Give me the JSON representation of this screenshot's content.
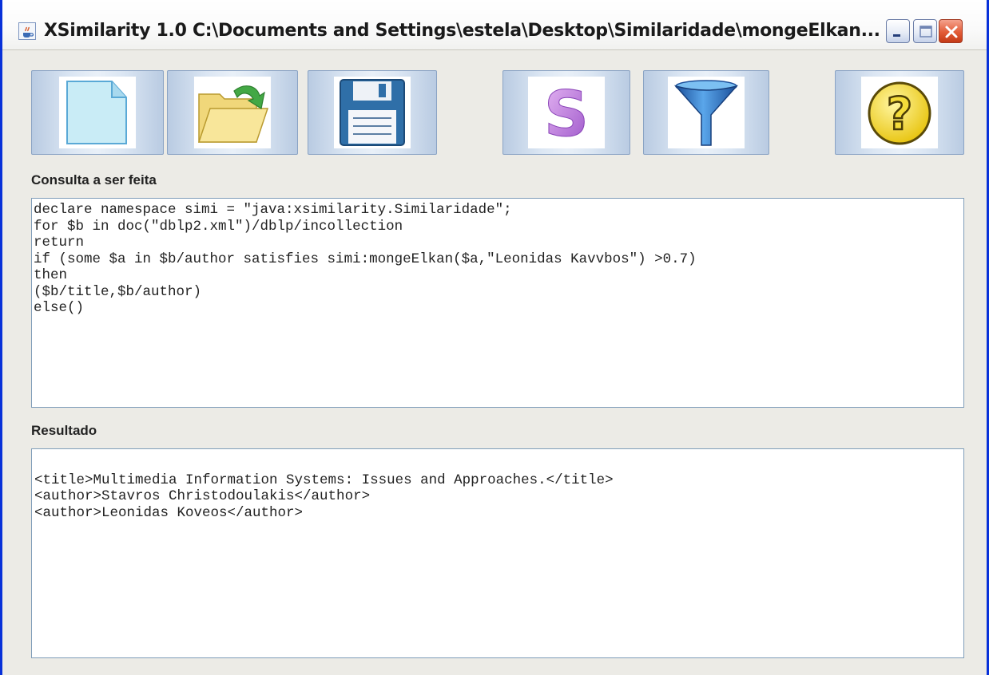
{
  "window": {
    "title": "XSimilarity 1.0 C:\\Documents and Settings\\estela\\Desktop\\Similaridade\\mongeElkan...",
    "app_icon": "java-cup-icon",
    "controls": [
      "minimize-icon",
      "maximize-icon",
      "close-icon"
    ]
  },
  "toolbar": {
    "buttons": [
      {
        "icon": "new-file-icon"
      },
      {
        "icon": "open-folder-icon"
      },
      {
        "icon": "save-disk-icon"
      },
      {
        "icon": "similarity-s-icon"
      },
      {
        "icon": "filter-funnel-icon"
      },
      {
        "icon": "help-question-icon"
      }
    ]
  },
  "query": {
    "label": "Consulta a ser feita",
    "lines": [
      "declare namespace simi = \"java:xsimilarity.Similaridade\";",
      "for $b in doc(\"dblp2.xml\")/dblp/incollection",
      "return",
      "if (some $a in $b/author satisfies simi:mongeElkan($a,\"Leonidas Kavvbos\") >0.7)",
      "then",
      "($b/title,$b/author)",
      "else()"
    ]
  },
  "result": {
    "label": "Resultado",
    "lines": [
      "",
      "<title>Multimedia Information Systems: Issues and Approaches.</title>",
      "<author>Stavros Christodoulakis</author>",
      "<author>Leonidas Koveos</author>"
    ]
  },
  "colors": {
    "window_bg": "#ecebe6",
    "border_blue": "#0831d9",
    "textarea_border": "#7f9db9"
  }
}
